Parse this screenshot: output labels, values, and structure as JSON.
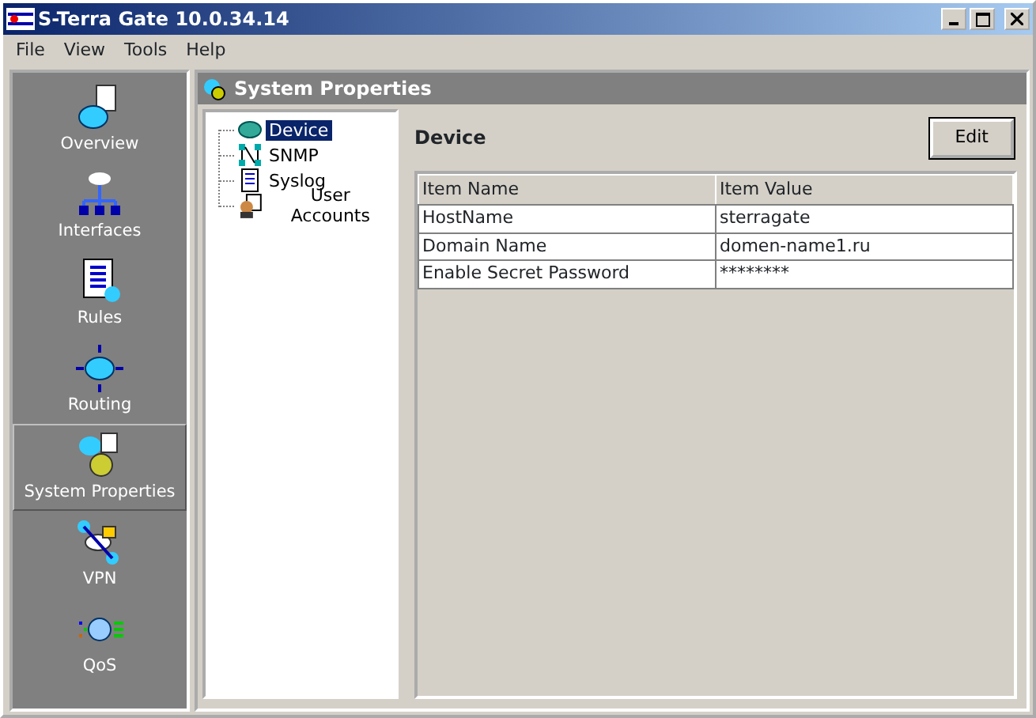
{
  "window": {
    "title": "S-Terra Gate 10.0.34.14"
  },
  "menu": [
    "File",
    "View",
    "Tools",
    "Help"
  ],
  "sidebar": {
    "items": [
      {
        "label": "Overview",
        "kind": "overview",
        "selected": false
      },
      {
        "label": "Interfaces",
        "kind": "interfaces",
        "selected": false
      },
      {
        "label": "Rules",
        "kind": "rules",
        "selected": false
      },
      {
        "label": "Routing",
        "kind": "routing",
        "selected": false
      },
      {
        "label": "System Properties",
        "kind": "system",
        "selected": true
      },
      {
        "label": "VPN",
        "kind": "vpn",
        "selected": false
      },
      {
        "label": "QoS",
        "kind": "qos",
        "selected": false
      }
    ]
  },
  "panel": {
    "title": "System Properties"
  },
  "tree": [
    {
      "label": "Device",
      "kind": "device",
      "selected": true
    },
    {
      "label": "SNMP",
      "kind": "snmp",
      "selected": false
    },
    {
      "label": "Syslog",
      "kind": "syslog",
      "selected": false
    },
    {
      "label": "User Accounts",
      "kind": "users",
      "selected": false
    }
  ],
  "section": {
    "title": "Device",
    "button": "Edit"
  },
  "table": {
    "columns": [
      "Item Name",
      "Item Value"
    ],
    "rows": [
      [
        "HostName",
        "sterragate"
      ],
      [
        "Domain Name",
        "domen-name1.ru"
      ],
      [
        "Enable Secret Password",
        "********"
      ]
    ]
  }
}
